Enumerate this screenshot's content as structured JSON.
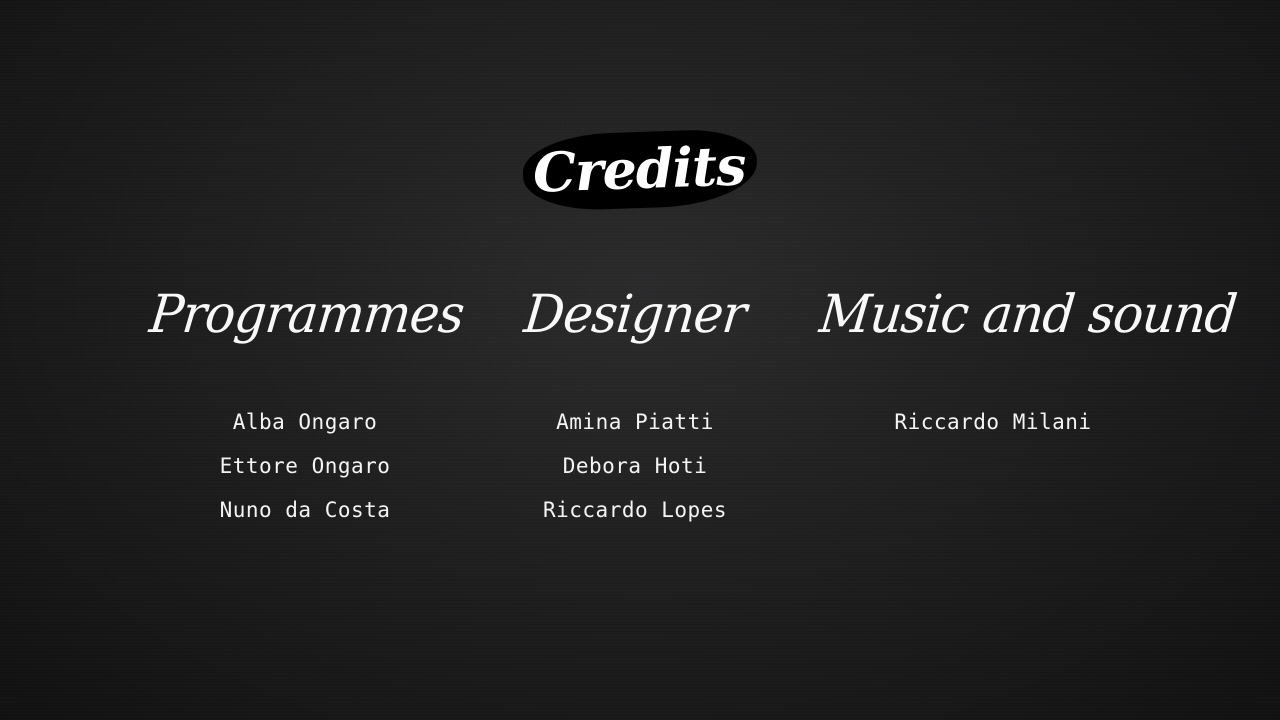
{
  "screen": {
    "title": "Credits",
    "colors": {
      "background": "#1f1f20",
      "text": "#f2f2f2",
      "title_backdrop": "#000000"
    }
  },
  "sections": [
    {
      "heading": "Programmes",
      "names": [
        "Alba Ongaro",
        "Ettore Ongaro",
        "Nuno da Costa"
      ]
    },
    {
      "heading": "Designer",
      "names": [
        "Amina Piatti",
        "Debora Hoti",
        "Riccardo Lopes"
      ]
    },
    {
      "heading": "Music and sound",
      "names": [
        "Riccardo Milani"
      ]
    }
  ]
}
